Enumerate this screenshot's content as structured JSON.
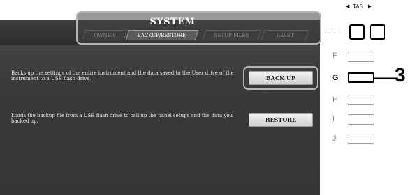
{
  "system": {
    "title": "SYSTEM",
    "tabs": [
      {
        "label": "OWNER",
        "active": false
      },
      {
        "label": "BACKUP/RESTORE",
        "active": true
      },
      {
        "label": "SETUP FILES",
        "active": false
      },
      {
        "label": "RESET",
        "active": false
      }
    ]
  },
  "rows": [
    {
      "description": "Backs up the settings of the entire instrument and the data saved to the User drive of the instrument to a USB flash drive.",
      "button_label": "BACK UP"
    },
    {
      "description": "Loads the backup file from a USB flash drive to call up the panel setups and the data you backed up.",
      "button_label": "RESTORE"
    }
  ],
  "side_buttons": [
    {
      "label": "F",
      "active": false
    },
    {
      "label": "G",
      "active": true
    },
    {
      "label": "H",
      "active": false
    },
    {
      "label": "I",
      "active": false
    },
    {
      "label": "J",
      "active": false
    }
  ],
  "tab_control": {
    "label": "TAB",
    "left_arrow": "◀",
    "right_arrow": "▶",
    "dots": "........"
  },
  "callout": {
    "number": "3"
  },
  "colors": {
    "screen_bg": "#3a3a3a",
    "highlight": "#b5b5b5",
    "active_tab": "#5c5c5c"
  }
}
